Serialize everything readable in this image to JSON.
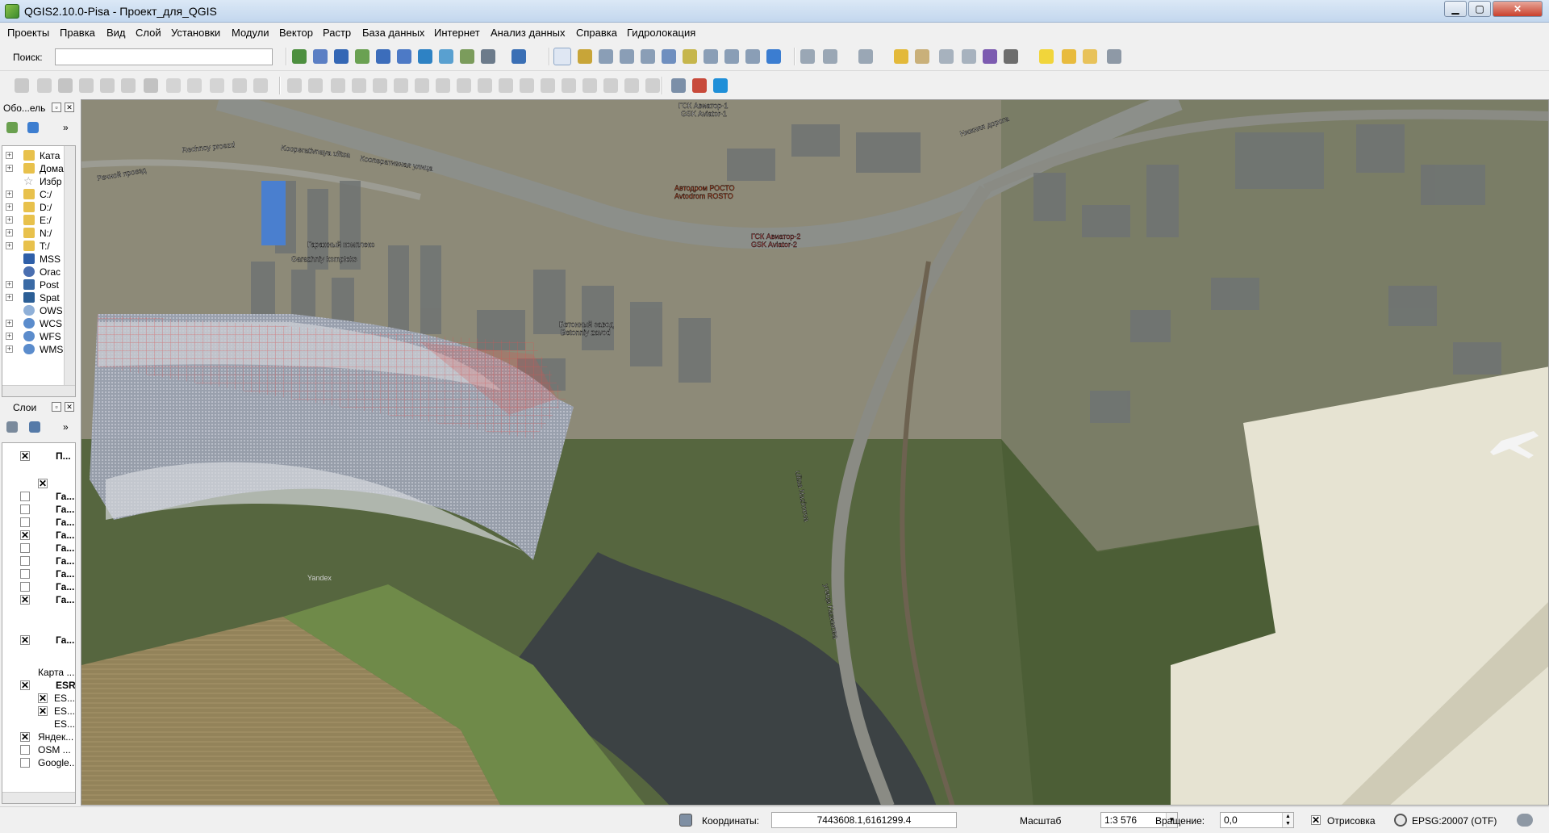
{
  "window": {
    "title": "QGIS2.10.0-Pisa - Проект_для_QGIS",
    "minimize": "▁",
    "maximize": "▢",
    "close": "✕"
  },
  "menubar": [
    "Проекты",
    "Правка",
    "Вид",
    "Слой",
    "Установки",
    "Модули",
    "Вектор",
    "Растр",
    "База данных",
    "Интернет",
    "Анализ данных",
    "Справка",
    "Гидролокация"
  ],
  "search": {
    "label": "Поиск:",
    "value": ""
  },
  "browser": {
    "title": "Обо...ель",
    "items": [
      "Ката",
      "Дома",
      "Избр",
      "C:/",
      "D:/",
      "E:/",
      "N:/",
      "T:/",
      "MSS",
      "Orac",
      "Post",
      "Spat",
      "OWS",
      "WCS",
      "WFS",
      "WMS"
    ]
  },
  "layers": {
    "title": "Слои",
    "items": [
      "П...",
      "Га...",
      "Га...",
      "Га...",
      "Га...",
      "Га...",
      "Га...",
      "Га...",
      "Га...",
      "Га...",
      "Га...",
      "Карта ...",
      "ESR",
      "ES...",
      "ES...",
      "ES...",
      "Яндек...",
      "OSM ...",
      "Google..."
    ]
  },
  "map": {
    "labels": [
      "ГСК Авиатор-1",
      "GSK Aviator-1",
      "Rechnoy proezd",
      "Речной проезд",
      "Kooperativnaya ulitsa",
      "Кооперативная улица",
      "Автодром РОСТО",
      "Avtodrom ROSTO",
      "ГСК Авиатор-2",
      "GSK Aviator-2",
      "Гаражный комплекс",
      "Garazhniy kompleks",
      "Бетонный завод",
      "Betonniy zavod",
      "Нижняя дорога",
      "Yandex",
      "ulitsa Nazimova",
      "улица Назимова"
    ]
  },
  "status": {
    "coord_label": "Координаты:",
    "coord_value": "7443608.1,6161299.4",
    "scale_label": "Масштаб",
    "scale_value": "1:3 576",
    "rotation_label": "Вращение:",
    "rotation_value": "0,0",
    "render_label": "Отрисовка",
    "crs": "EPSG:20007 (OTF)"
  },
  "colors": {
    "road": "#8c8f8a",
    "water": "#3d4447",
    "sonar_overlay": "#a8adb8",
    "grid_red": "#d9534f",
    "airport": "#e9e7d8"
  }
}
